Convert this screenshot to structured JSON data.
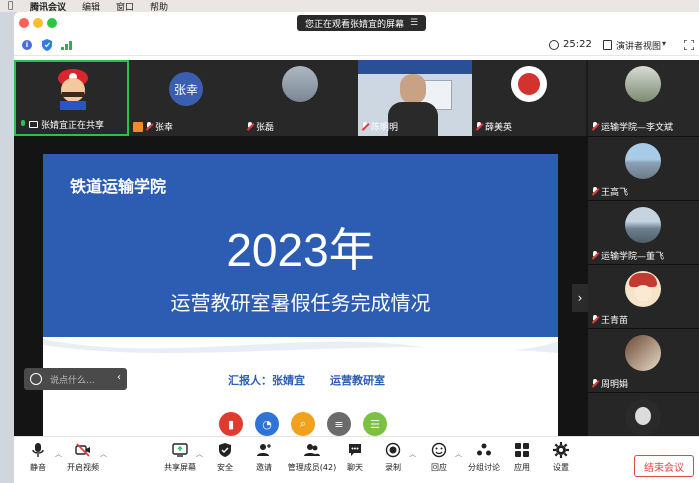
{
  "menubar": {
    "app": "腾讯会议",
    "items": [
      "编辑",
      "窗口",
      "帮助"
    ]
  },
  "banner": {
    "text": "您正在观看张婧宜的屏幕",
    "menu_glyph": "☰"
  },
  "topbar": {
    "timer": "25:22",
    "view_label": "演讲者视图",
    "caret": "▾"
  },
  "participants": [
    {
      "name": "张婧宜正在共享"
    },
    {
      "name": "张幸",
      "avatar_text": "张幸"
    },
    {
      "name": "张磊"
    },
    {
      "name": "陈明明"
    },
    {
      "name": "薛美英"
    },
    {
      "name": "运输学院—李文斌"
    }
  ],
  "right_participants": [
    {
      "name": "王高飞"
    },
    {
      "name": "运输学院—董飞"
    },
    {
      "name": "王青苗"
    },
    {
      "name": "周明娟"
    }
  ],
  "slide": {
    "logo": "铁道运输学院",
    "year": "2023年",
    "subtitle": "运营教研室暑假任务完成情况",
    "reporter": "汇报人：张婧宜",
    "dept": "运营教研室"
  },
  "chat": {
    "placeholder": "说点什么...",
    "collapse": "‹"
  },
  "nav": {
    "next": "›"
  },
  "toolbar": {
    "mute": "静音",
    "video": "开启视频",
    "share": "共享屏幕",
    "security": "安全",
    "invite": "邀请",
    "members": "管理成员(42)",
    "chat": "聊天",
    "record": "录制",
    "react": "回应",
    "breakout": "分组讨论",
    "apps": "应用",
    "settings": "设置",
    "end": "结束会议"
  },
  "colors": {
    "accent": "#2c5db2",
    "active_border": "#27c24c",
    "danger": "#e04848"
  }
}
